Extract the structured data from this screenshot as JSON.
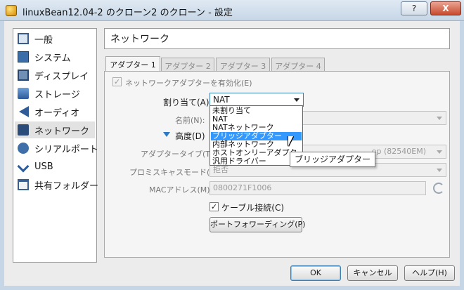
{
  "window": {
    "title": "linuxBean12.04-2 のクローン2 のクローン - 設定",
    "help_button": "?",
    "close_button": "X"
  },
  "sidebar": {
    "items": [
      {
        "label": "一般",
        "icon": "general-icon"
      },
      {
        "label": "システム",
        "icon": "system-icon"
      },
      {
        "label": "ディスプレイ",
        "icon": "display-icon"
      },
      {
        "label": "ストレージ",
        "icon": "storage-icon"
      },
      {
        "label": "オーディオ",
        "icon": "audio-icon"
      },
      {
        "label": "ネットワーク",
        "icon": "network-icon",
        "selected": true
      },
      {
        "label": "シリアルポート",
        "icon": "serial-port-icon"
      },
      {
        "label": "USB",
        "icon": "usb-icon"
      },
      {
        "label": "共有フォルダー",
        "icon": "shared-folder-icon"
      }
    ]
  },
  "main": {
    "section_title": "ネットワーク",
    "tabs": [
      {
        "label": "アダプター 1",
        "active": true
      },
      {
        "label": "アダプター 2",
        "active": false
      },
      {
        "label": "アダプター 3",
        "active": false
      },
      {
        "label": "アダプター 4",
        "active": false
      }
    ],
    "enable_adapter_label": "ネットワークアダプターを有効化(E)",
    "enable_adapter_checked": true,
    "attached_to_label": "割り当て(A):",
    "attached_to_value": "NAT",
    "name_label": "名前(N):",
    "advanced_label": "高度(D)",
    "adapter_type_label": "アダプタータイプ(T):",
    "adapter_type_value": "op (82540EM)",
    "promiscuous_label": "プロミスキャスモード(P):",
    "promiscuous_value": "拒否",
    "mac_label": "MACアドレス(M):",
    "mac_value": "0800271F1006",
    "cable_connected_label": "ケーブル接続(C)",
    "cable_connected_checked": true,
    "port_forwarding_button": "ポートフォワーディング(P)"
  },
  "dropdown": {
    "options": [
      "未割り当て",
      "NAT",
      "NATネットワーク",
      "ブリッジアダプター",
      "内部ネットワーク",
      "ホストオンリーアダプター",
      "汎用ドライバー"
    ],
    "highlighted": "ブリッジアダプター"
  },
  "tooltip": "ブリッジアダプター",
  "footer": {
    "ok": "OK",
    "cancel": "キャンセル",
    "help": "ヘルプ(H)"
  },
  "colors": {
    "accent": "#3c7fb1",
    "selection": "#3399ff"
  }
}
